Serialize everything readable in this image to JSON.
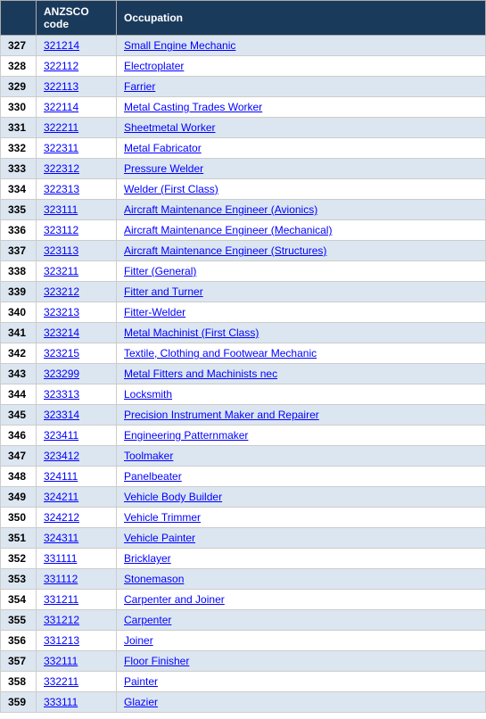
{
  "header": {
    "col1": "",
    "col2": "ANZSCO code",
    "col3": "Occupation"
  },
  "rows": [
    {
      "num": "327",
      "code": "321214",
      "occupation": "Small Engine Mechanic"
    },
    {
      "num": "328",
      "code": "322112",
      "occupation": "Electroplater"
    },
    {
      "num": "329",
      "code": "322113",
      "occupation": "Farrier"
    },
    {
      "num": "330",
      "code": "322114",
      "occupation": "Metal Casting Trades Worker"
    },
    {
      "num": "331",
      "code": "322211",
      "occupation": "Sheetmetal Worker"
    },
    {
      "num": "332",
      "code": "322311",
      "occupation": "Metal Fabricator"
    },
    {
      "num": "333",
      "code": "322312",
      "occupation": "Pressure Welder"
    },
    {
      "num": "334",
      "code": "322313",
      "occupation": "Welder (First Class)"
    },
    {
      "num": "335",
      "code": "323111",
      "occupation": "Aircraft Maintenance Engineer (Avionics)"
    },
    {
      "num": "336",
      "code": "323112",
      "occupation": "Aircraft Maintenance Engineer (Mechanical)"
    },
    {
      "num": "337",
      "code": "323113",
      "occupation": "Aircraft Maintenance Engineer (Structures)"
    },
    {
      "num": "338",
      "code": "323211",
      "occupation": "Fitter (General)"
    },
    {
      "num": "339",
      "code": "323212",
      "occupation": "Fitter and Turner"
    },
    {
      "num": "340",
      "code": "323213",
      "occupation": "Fitter-Welder"
    },
    {
      "num": "341",
      "code": "323214",
      "occupation": "Metal Machinist (First Class)"
    },
    {
      "num": "342",
      "code": "323215",
      "occupation": "Textile, Clothing and Footwear Mechanic"
    },
    {
      "num": "343",
      "code": "323299",
      "occupation": "Metal Fitters and Machinists nec"
    },
    {
      "num": "344",
      "code": "323313",
      "occupation": "Locksmith"
    },
    {
      "num": "345",
      "code": "323314",
      "occupation": "Precision Instrument Maker and Repairer"
    },
    {
      "num": "346",
      "code": "323411",
      "occupation": "Engineering Patternmaker"
    },
    {
      "num": "347",
      "code": "323412",
      "occupation": "Toolmaker"
    },
    {
      "num": "348",
      "code": "324111",
      "occupation": "Panelbeater"
    },
    {
      "num": "349",
      "code": "324211",
      "occupation": "Vehicle Body Builder"
    },
    {
      "num": "350",
      "code": "324212",
      "occupation": "Vehicle Trimmer"
    },
    {
      "num": "351",
      "code": "324311",
      "occupation": "Vehicle Painter"
    },
    {
      "num": "352",
      "code": "331111",
      "occupation": "Bricklayer"
    },
    {
      "num": "353",
      "code": "331112",
      "occupation": "Stonemason"
    },
    {
      "num": "354",
      "code": "331211",
      "occupation": "Carpenter and Joiner"
    },
    {
      "num": "355",
      "code": "331212",
      "occupation": "Carpenter"
    },
    {
      "num": "356",
      "code": "331213",
      "occupation": "Joiner"
    },
    {
      "num": "357",
      "code": "332111",
      "occupation": "Floor Finisher"
    },
    {
      "num": "358",
      "code": "332211",
      "occupation": "Painter"
    },
    {
      "num": "359",
      "code": "333111",
      "occupation": "Glazier"
    }
  ]
}
